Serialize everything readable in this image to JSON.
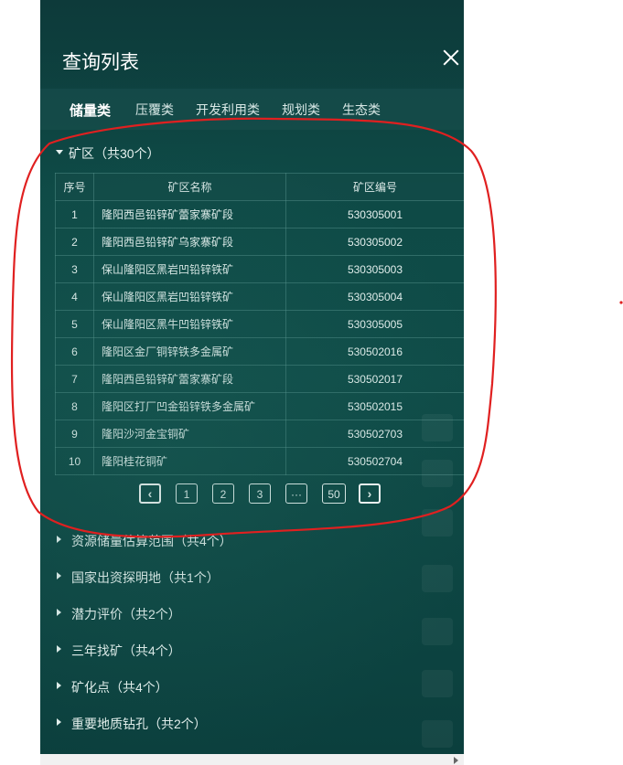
{
  "panel": {
    "title": "查询列表",
    "tabs": [
      "储量类",
      "压覆类",
      "开发利用类",
      "规划类",
      "生态类"
    ],
    "active_tab": 0
  },
  "mine_section": {
    "label": "矿区（共30个）",
    "columns": [
      "序号",
      "矿区名称",
      "矿区编号"
    ],
    "rows": [
      {
        "no": "1",
        "name": "隆阳西邑铅锌矿蕾家寨矿段",
        "code": "530305001"
      },
      {
        "no": "2",
        "name": "隆阳西邑铅锌矿乌家寨矿段",
        "code": "530305002"
      },
      {
        "no": "3",
        "name": "保山隆阳区黑岩凹铅锌铁矿",
        "code": "530305003"
      },
      {
        "no": "4",
        "name": "保山隆阳区黑岩凹铅锌铁矿",
        "code": "530305004"
      },
      {
        "no": "5",
        "name": "保山隆阳区黑牛凹铅锌铁矿",
        "code": "530305005"
      },
      {
        "no": "6",
        "name": "隆阳区金厂铜锌铁多金属矿",
        "code": "530502016"
      },
      {
        "no": "7",
        "name": "隆阳西邑铅锌矿蕾家寨矿段",
        "code": "530502017"
      },
      {
        "no": "8",
        "name": "隆阳区打厂凹金铅锌铁多金属矿",
        "code": "530502015"
      },
      {
        "no": "9",
        "name": "隆阳沙河金宝铜矿",
        "code": "530502703"
      },
      {
        "no": "10",
        "name": "隆阳桂花铜矿",
        "code": "530502704"
      }
    ],
    "pagination": {
      "prev": "‹",
      "pages": [
        "1",
        "2",
        "3",
        "···",
        "50"
      ],
      "next": "›"
    }
  },
  "sections": [
    "资源储量估算范围（共4个）",
    "国家出资探明地（共1个）",
    "潜力评价（共2个）",
    "三年找矿（共4个）",
    "矿化点（共4个）",
    "重要地质钻孔（共2个）"
  ],
  "icons": [
    "close-icon",
    "caret-down-icon",
    "caret-right-icon",
    "chevron-left-icon",
    "chevron-right-icon",
    "scroll-right-icon"
  ],
  "colors": {
    "panel": "#0e4a46",
    "annotation": "#e02020"
  }
}
